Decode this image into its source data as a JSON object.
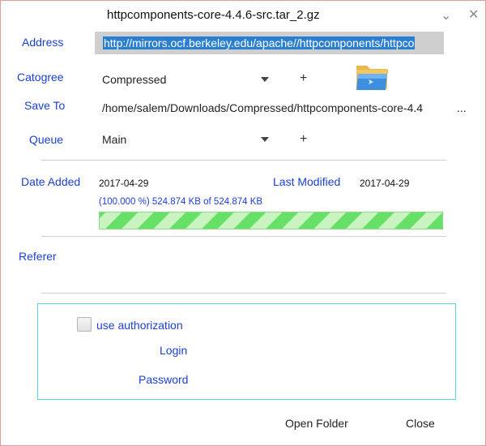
{
  "window": {
    "title": "httpcomponents-core-4.4.6-src.tar_2.gz",
    "minimize_glyph": "⌄",
    "close_glyph": "✕"
  },
  "form": {
    "address_label": "Address",
    "address_value": "http://mirrors.ocf.berkeley.edu/apache//httpcomponents/httpco",
    "category_label": "Catogree",
    "category_value": "Compressed",
    "category_add": "+",
    "save_to_label": "Save To",
    "save_to_value": "/home/salem/Downloads/Compressed/httpcomponents-core-4.4",
    "save_to_browse": "...",
    "queue_label": "Queue",
    "queue_value": "Main",
    "queue_add": "+"
  },
  "info": {
    "date_added_label": "Date Added",
    "date_added_value": "2017-04-29",
    "last_modified_label": "Last Modified",
    "last_modified_value": "2017-04-29",
    "progress_text": "(100.000 %) 524.874 KB of 524.874 KB",
    "progress_fraction": 1.0
  },
  "referer": {
    "label": "Referer"
  },
  "auth": {
    "use_authorization_label": "use authorization",
    "use_authorization_checked": false,
    "login_label": "Login",
    "password_label": "Password"
  },
  "footer": {
    "open_folder_label": "Open Folder",
    "close_label": "Close"
  },
  "icons": {
    "folder": "folder-icon",
    "dropdown": "chevron-down-icon"
  },
  "colors": {
    "label_blue": "#1a3fd6",
    "selection_blue": "#2a7fcf",
    "progress_green": "#66e066",
    "auth_border": "#59d9e8"
  }
}
